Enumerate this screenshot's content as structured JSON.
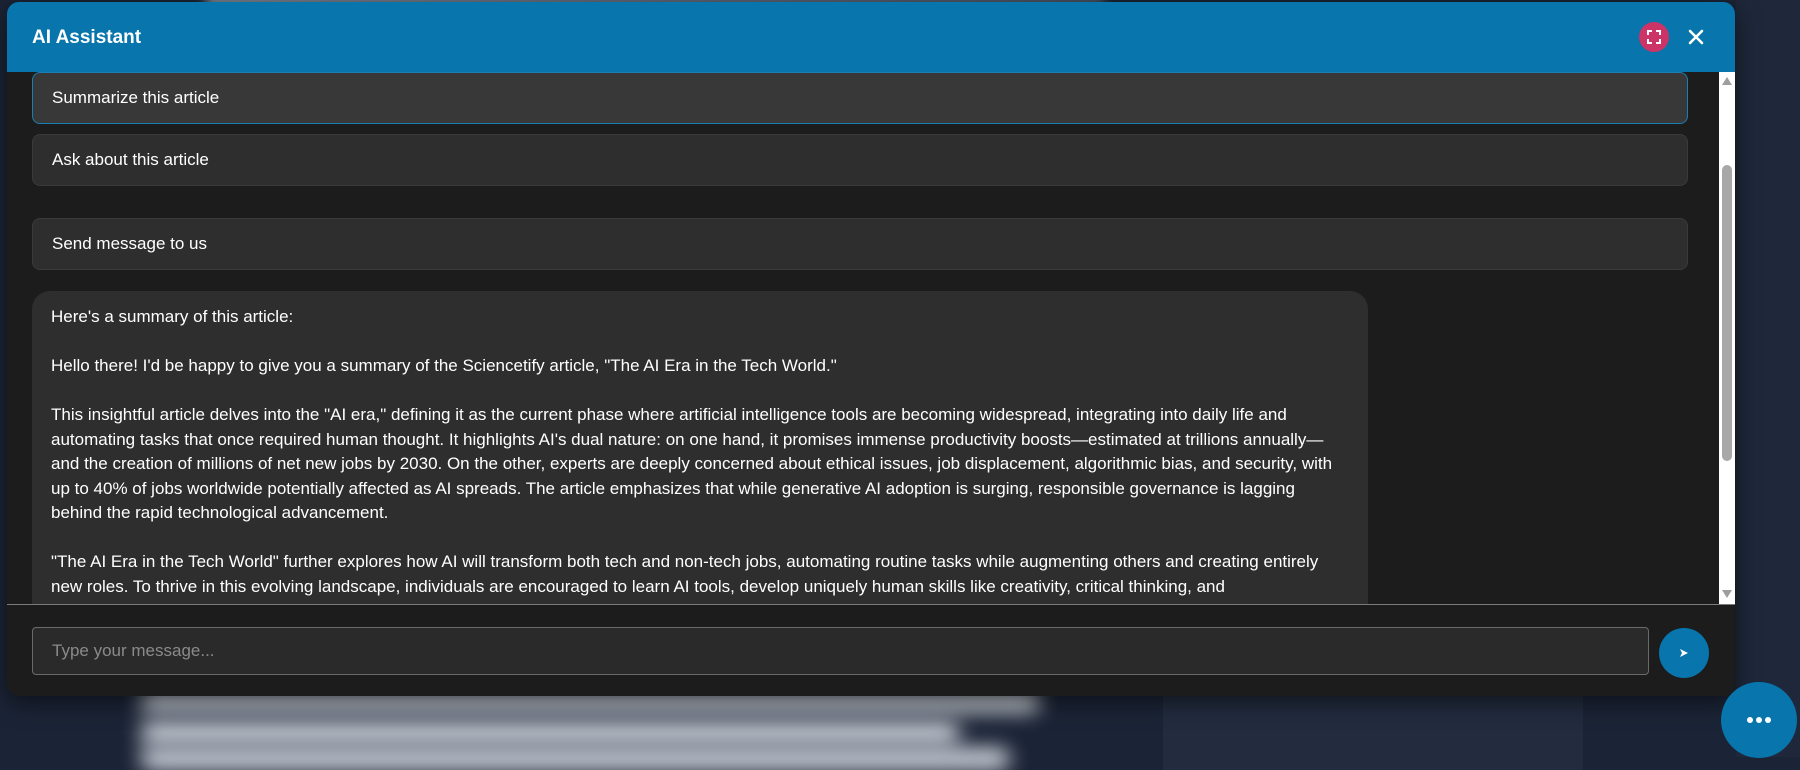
{
  "chat": {
    "title": "AI Assistant",
    "header_color": "#0875ad",
    "expand_icon": "fullscreen-icon",
    "close_icon": "close-icon",
    "options": [
      {
        "label": "Summarize this article"
      },
      {
        "label": "Ask about this article"
      },
      {
        "label": "Send message to us"
      }
    ],
    "assistant_message": {
      "paragraphs": [
        "Here's a summary of this article:",
        "Hello there! I'd be happy to give you a summary of the Sciencetify article, \"The AI Era in the Tech World.\"",
        "This insightful article delves into the \"AI era,\" defining it as the current phase where artificial intelligence tools are becoming widespread, integrating into daily life and automating tasks that once required human thought. It highlights AI's dual nature: on one hand, it promises immense productivity boosts—estimated at trillions annually—and the creation of millions of net new jobs by 2030. On the other, experts are deeply concerned about ethical issues, job displacement, algorithmic bias, and security, with up to 40% of jobs worldwide potentially affected as AI spreads. The article emphasizes that while generative AI adoption is surging, responsible governance is lagging behind the rapid technological advancement.",
        "\"The AI Era in the Tech World\" further explores how AI will transform both tech and non-tech jobs, automating routine tasks while augmenting others and creating entirely new roles. To thrive in this evolving landscape, individuals are encouraged to learn AI tools, develop uniquely human skills like creativity, critical thinking, and"
      ]
    },
    "input": {
      "placeholder": "Type your message...",
      "value": ""
    },
    "send_label": "➤",
    "launcher_icon": "more-dots-icon"
  }
}
